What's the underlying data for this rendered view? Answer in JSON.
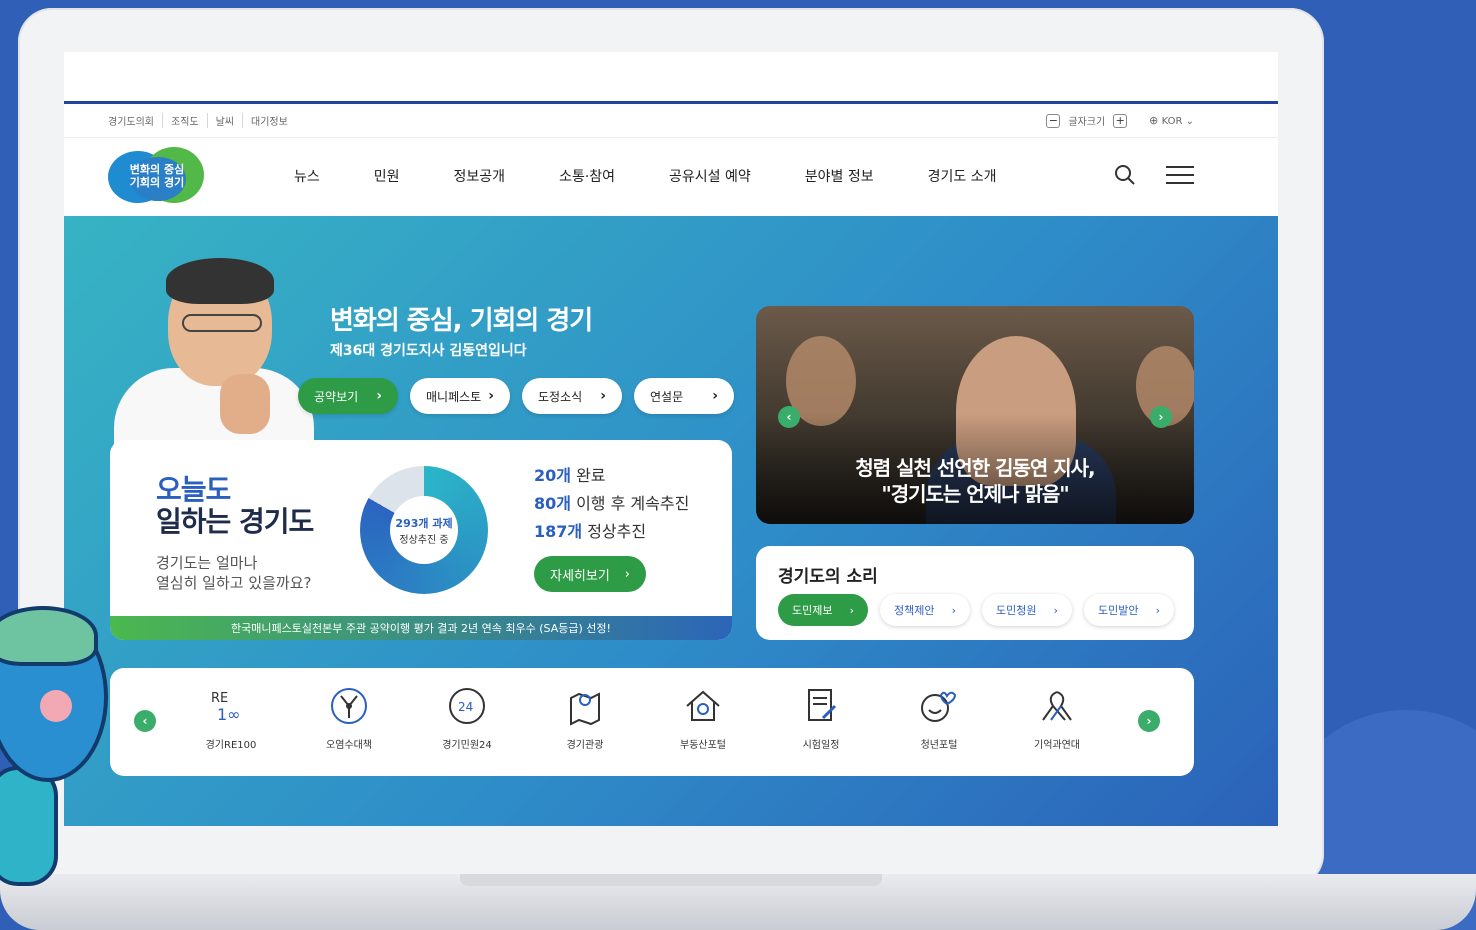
{
  "util": {
    "links": [
      "경기도의회",
      "조직도",
      "날씨",
      "대기정보"
    ],
    "font_size_label": "글자크기",
    "lang": "KOR"
  },
  "logo": {
    "line1": "변화의 중심",
    "line2": "기회의 경기"
  },
  "nav": [
    "뉴스",
    "민원",
    "정보공개",
    "소통·참여",
    "공유시설 예약",
    "분야별 정보",
    "경기도 소개"
  ],
  "hero": {
    "title": "변화의 중심, 기회의 경기",
    "subtitle": "제36대 경기도지사 김동연입니다",
    "buttons": [
      "공약보기",
      "매니페스토",
      "도정소식",
      "연설문"
    ]
  },
  "today_card": {
    "line1": "오늘도",
    "line2": "일하는 경기도",
    "question1": "경기도는 얼마나",
    "question2": "열심히 일하고 있을까요?",
    "donut_line1": "293개 과제",
    "donut_line2": "정상추진 중",
    "stats": [
      {
        "num": "20개",
        "text": " 완료"
      },
      {
        "num": "80개",
        "text": " 이행 후 계속추진"
      },
      {
        "num": "187개",
        "text": " 정상추진"
      }
    ],
    "detail_label": "자세히보기",
    "award": "한국매니페스토실천본부 주관 공약이행 평가 결과 2년 연속 최우수 (SA등급) 선정!"
  },
  "video": {
    "caption1": "청렴 실천 선언한 김동연 지사,",
    "caption2": "\"경기도는 언제나 맑음\""
  },
  "voice": {
    "title": "경기도의 소리",
    "buttons": [
      "도민제보",
      "정책제안",
      "도민청원",
      "도민발안"
    ]
  },
  "quick_links": [
    {
      "label": "경기RE100",
      "icon": "re100-icon"
    },
    {
      "label": "오염수대책",
      "icon": "radiation-icon"
    },
    {
      "label": "경기민원24",
      "icon": "clock-24-icon"
    },
    {
      "label": "경기관광",
      "icon": "map-pin-icon"
    },
    {
      "label": "부동산포털",
      "icon": "house-search-icon"
    },
    {
      "label": "시험일정",
      "icon": "document-pen-icon"
    },
    {
      "label": "청년포털",
      "icon": "smile-heart-icon"
    },
    {
      "label": "기억과연대",
      "icon": "ribbon-icon"
    }
  ],
  "colors": {
    "primary_blue": "#2a5fbf",
    "green": "#2e9b47",
    "teal": "#37b3c4"
  }
}
